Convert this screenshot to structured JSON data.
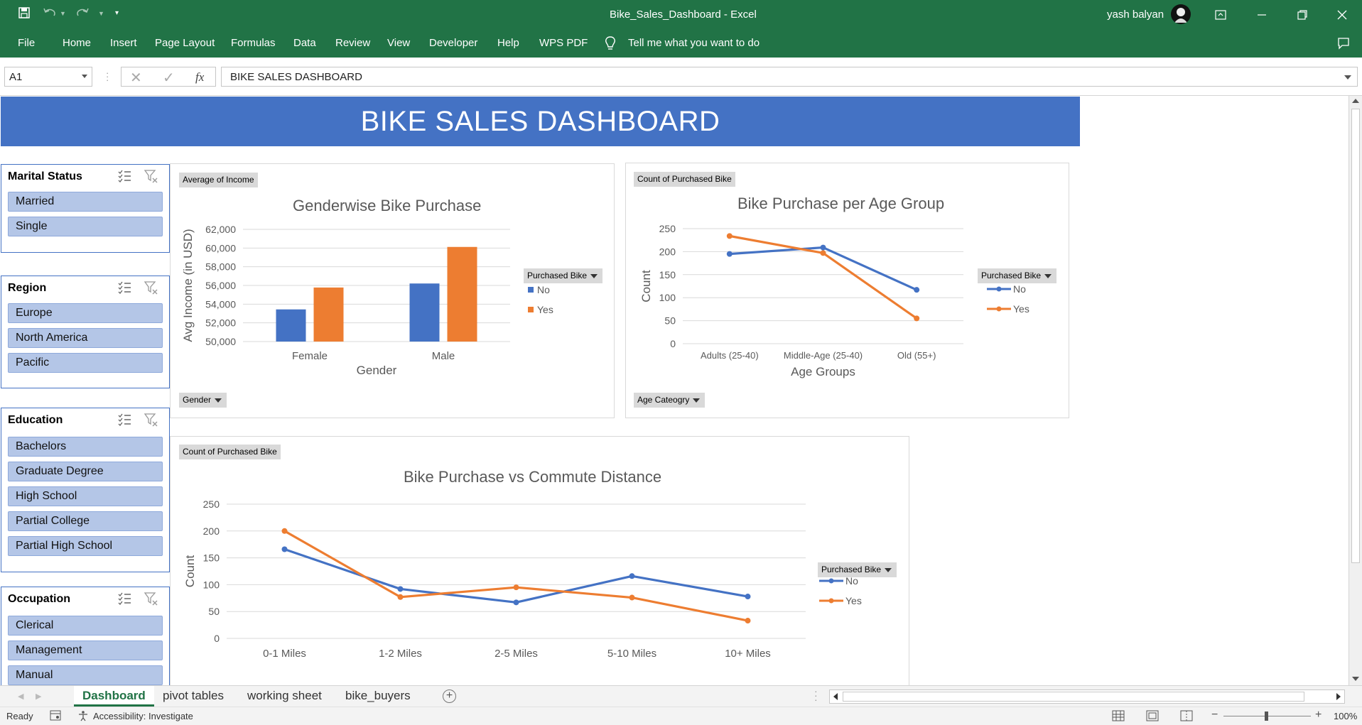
{
  "window": {
    "title": "Bike_Sales_Dashboard  -  Excel",
    "user": "yash balyan"
  },
  "menu": [
    "File",
    "Home",
    "Insert",
    "Page Layout",
    "Formulas",
    "Data",
    "Review",
    "View",
    "Developer",
    "Help",
    "WPS PDF"
  ],
  "tell_me": "Tell me what you want to do",
  "formula_bar": {
    "name_box": "A1",
    "fx": "fx",
    "content": "BIKE SALES DASHBOARD"
  },
  "dashboard_title": "BIKE SALES DASHBOARD",
  "slicers": [
    {
      "title": "Marital Status",
      "items": [
        "Married",
        "Single"
      ]
    },
    {
      "title": "Region",
      "items": [
        "Europe",
        "North America",
        "Pacific"
      ]
    },
    {
      "title": "Education",
      "items": [
        "Bachelors",
        "Graduate Degree",
        "High School",
        "Partial College",
        "Partial High School"
      ]
    },
    {
      "title": "Occupation",
      "items": [
        "Clerical",
        "Management",
        "Manual"
      ]
    }
  ],
  "charts": {
    "gender": {
      "value_button": "Average of Income",
      "axis_button": "Gender",
      "legend_button": "Purchased Bike"
    },
    "age": {
      "value_button": "Count of Purchased Bike",
      "axis_button": "Age Cateogry",
      "legend_button": "Purchased Bike"
    },
    "commute": {
      "value_button": "Count of Purchased Bike",
      "legend_button": "Purchased Bike"
    }
  },
  "chart_data": [
    {
      "type": "bar",
      "title": "Genderwise Bike Purchase",
      "xlabel": "Gender",
      "ylabel": "Avg Income (in USD)",
      "categories": [
        "Female",
        "Male"
      ],
      "ylim": [
        50000,
        62000
      ],
      "yticks": [
        "50,000",
        "52,000",
        "54,000",
        "56,000",
        "58,000",
        "60,000",
        "62,000"
      ],
      "legend": "right",
      "series": [
        {
          "name": "No",
          "color": "#4472c4",
          "values": [
            53440,
            56210
          ]
        },
        {
          "name": "Yes",
          "color": "#ed7d31",
          "values": [
            55780,
            60120
          ]
        }
      ]
    },
    {
      "type": "line",
      "title": "Bike Purchase per Age Group",
      "xlabel": "Age Groups",
      "ylabel": "Count",
      "categories": [
        "Adults (25-40)",
        "Middle-Age (25-40)",
        "Old (55+)"
      ],
      "ylim": [
        0,
        250
      ],
      "yticks": [
        "0",
        "50",
        "100",
        "150",
        "200",
        "250"
      ],
      "legend": "right",
      "series": [
        {
          "name": "No",
          "color": "#4472c4",
          "values": [
            195,
            209,
            117
          ]
        },
        {
          "name": "Yes",
          "color": "#ed7d31",
          "values": [
            234,
            197,
            55
          ]
        }
      ]
    },
    {
      "type": "line",
      "title": "Bike Purchase vs Commute Distance",
      "xlabel": "",
      "ylabel": "Count",
      "categories": [
        "0-1 Miles",
        "1-2 Miles",
        "2-5 Miles",
        "5-10 Miles",
        "10+ Miles"
      ],
      "ylim": [
        0,
        250
      ],
      "yticks": [
        "0",
        "50",
        "100",
        "150",
        "200",
        "250"
      ],
      "legend": "right",
      "series": [
        {
          "name": "No",
          "color": "#4472c4",
          "values": [
            166,
            92,
            67,
            116,
            78
          ]
        },
        {
          "name": "Yes",
          "color": "#ed7d31",
          "values": [
            200,
            77,
            95,
            76,
            33
          ]
        }
      ]
    }
  ],
  "sheet_tabs": [
    "Dashboard",
    "pivot tables",
    "working sheet",
    "bike_buyers"
  ],
  "status": {
    "ready": "Ready",
    "accessibility": "Accessibility: Investigate",
    "zoom": "100%"
  }
}
